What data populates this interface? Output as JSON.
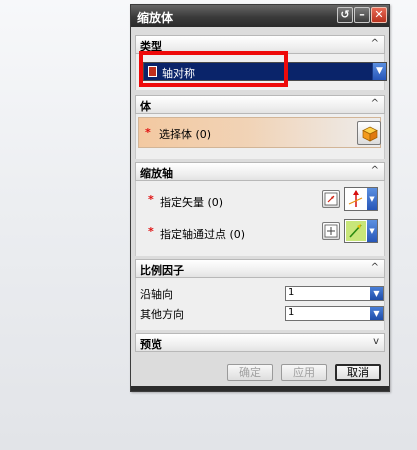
{
  "dialog": {
    "title": "缩放体",
    "controls": {
      "reset": "↺",
      "minimize": "–",
      "close": "✕"
    }
  },
  "sections": {
    "type": {
      "header": "类型",
      "collapse_glyph": "^",
      "selected": "轴对称",
      "dropdown_glyph": "▼"
    },
    "body": {
      "header": "体",
      "collapse_glyph": "^",
      "required_mark": "*",
      "select_label": "选择体 (0)"
    },
    "axis": {
      "header": "缩放轴",
      "collapse_glyph": "^",
      "required_mark": "*",
      "vector_label": "指定矢量 (0)",
      "point_label": "指定轴通过点 (0)"
    },
    "scale": {
      "header": "比例因子",
      "collapse_glyph": "^",
      "along_axis_label": "沿轴向",
      "along_axis_value": "1",
      "other_dir_label": "其他方向",
      "other_dir_value": "1"
    },
    "preview": {
      "header": "预览",
      "collapse_glyph": "v"
    }
  },
  "footer": {
    "ok_label": "确定",
    "apply_label": "应用",
    "cancel_label": "取消"
  },
  "icons": [
    "reset-icon",
    "minimize-icon",
    "close-icon",
    "cube-icon",
    "vector-dialog-icon",
    "vector-icon",
    "point-dialog-icon",
    "point-icon"
  ],
  "colors": {
    "highlight_box": "#ee0a0a",
    "combo_selection": "#0a246a",
    "required_star": "#e01010"
  }
}
